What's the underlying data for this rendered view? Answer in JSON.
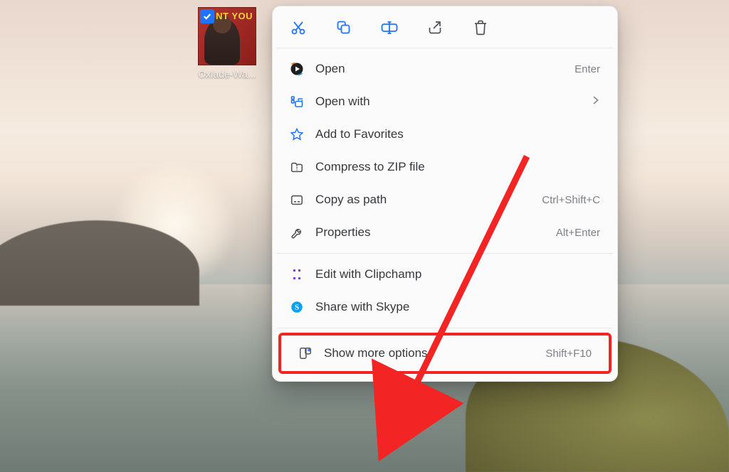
{
  "desktop": {
    "file_label": "Oxlade-Wa...",
    "thumb_text": "NT YOU",
    "selected": true
  },
  "toolbar": {
    "cut": "Cut",
    "copy": "Copy",
    "rename": "Rename",
    "share": "Share",
    "delete": "Delete"
  },
  "menu": {
    "section1": [
      {
        "label": "Open",
        "shortcut": "Enter",
        "icon": "play"
      },
      {
        "label": "Open with",
        "shortcut": "",
        "icon": "openwith",
        "submenu": true
      },
      {
        "label": "Add to Favorites",
        "shortcut": "",
        "icon": "star"
      },
      {
        "label": "Compress to ZIP file",
        "shortcut": "",
        "icon": "zip"
      },
      {
        "label": "Copy as path",
        "shortcut": "Ctrl+Shift+C",
        "icon": "copypath"
      },
      {
        "label": "Properties",
        "shortcut": "Alt+Enter",
        "icon": "properties"
      }
    ],
    "section2": [
      {
        "label": "Edit with Clipchamp",
        "shortcut": "",
        "icon": "clipchamp"
      },
      {
        "label": "Share with Skype",
        "shortcut": "",
        "icon": "skype"
      }
    ],
    "section3": [
      {
        "label": "Show more options",
        "shortcut": "Shift+F10",
        "icon": "moreoptions"
      }
    ]
  },
  "overlay_label": "Share with Skype"
}
